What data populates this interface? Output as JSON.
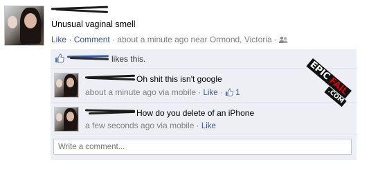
{
  "post": {
    "text": "Unusual vaginal smell",
    "actions": {
      "like": "Like",
      "comment": "Comment"
    },
    "meta": "about a minute ago near Ormond, Victoria",
    "separator": "·"
  },
  "likes": {
    "text": "likes this."
  },
  "comments": [
    {
      "text": "Oh shit this isn't google",
      "meta": "about a minute ago via mobile",
      "like": "Like",
      "like_count": "1"
    },
    {
      "text": "How do you delete of an iPhone",
      "meta": "a few seconds ago via mobile",
      "like": "Like"
    }
  ],
  "composer": {
    "placeholder": "Write a comment..."
  },
  "watermark": {
    "part1": "EPIC",
    "part2": "FAIL",
    "part3": ".COM"
  },
  "colors": {
    "link": "#3b5998",
    "meta": "#808080",
    "feedback_bg": "#edeff4",
    "watermark_accent": "#d40000"
  },
  "icons": {
    "friends": "friends-icon",
    "thumbs_up": "thumbs-up-icon"
  }
}
